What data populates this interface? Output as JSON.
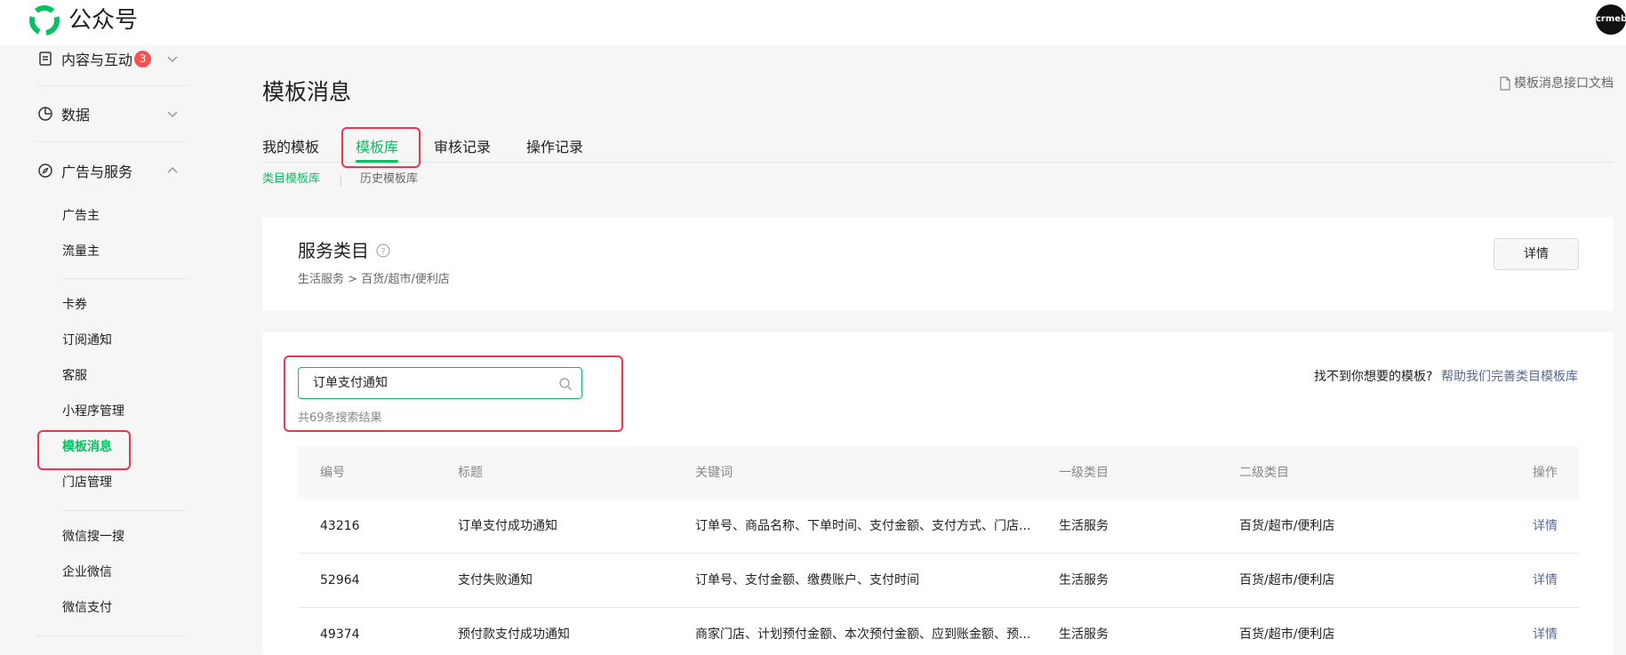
{
  "header": {
    "brand": "公众号",
    "avatar_text": "crmeb"
  },
  "sidebar": {
    "groups": [
      {
        "label": "内容与互动",
        "badge": "3"
      },
      {
        "label": "数据"
      },
      {
        "label": "广告与服务"
      }
    ],
    "items": [
      "广告主",
      "流量主",
      "卡券",
      "订阅通知",
      "客服",
      "小程序管理",
      "模板消息",
      "门店管理",
      "微信搜一搜",
      "企业微信",
      "微信支付"
    ],
    "active_item": "模板消息"
  },
  "main": {
    "title": "模板消息",
    "doc_link": "模板消息接口文档",
    "tabs": [
      "我的模板",
      "模板库",
      "审核记录",
      "操作记录"
    ],
    "active_tab": "模板库",
    "subtabs": [
      "类目模板库",
      "历史模板库"
    ],
    "active_subtab": "类目模板库",
    "service": {
      "title": "服务类目",
      "path": "生活服务 > 百货/超市/便利店",
      "detail_label": "详情"
    },
    "search": {
      "value": "订单支付通知",
      "result_count": "共69条搜索结果"
    },
    "help": {
      "question": "找不到你想要的模板?",
      "link": "帮助我们完善类目模板库"
    },
    "table": {
      "headers": [
        "编号",
        "标题",
        "关键词",
        "一级类目",
        "二级类目",
        "操作"
      ],
      "rows": [
        {
          "id": "43216",
          "title": "订单支付成功通知",
          "keywords": "订单号、商品名称、下单时间、支付金额、支付方式、门店...",
          "cat1": "生活服务",
          "cat2": "百货/超市/便利店",
          "op": "详情"
        },
        {
          "id": "52964",
          "title": "支付失败通知",
          "keywords": "订单号、支付金额、缴费账户、支付时间",
          "cat1": "生活服务",
          "cat2": "百货/超市/便利店",
          "op": "详情"
        },
        {
          "id": "49374",
          "title": "预付款支付成功通知",
          "keywords": "商家门店、计划预付金额、本次预付金额、应到账金额、预...",
          "cat1": "生活服务",
          "cat2": "百货/超市/便利店",
          "op": "详情"
        }
      ]
    }
  },
  "colors": {
    "accent": "#07c160",
    "link": "#576b95",
    "highlight_box": "#f0344e",
    "badge": "#fa5151"
  }
}
